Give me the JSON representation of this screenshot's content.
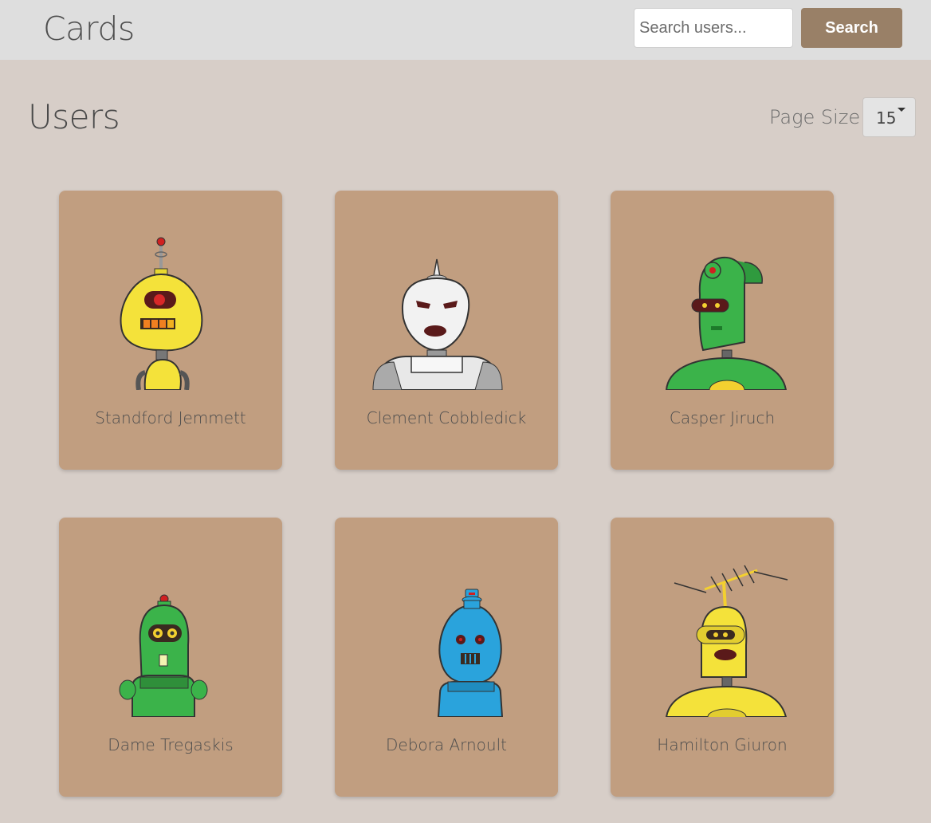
{
  "navbar": {
    "brand": "Cards",
    "search_placeholder": "Search users...",
    "search_value": "",
    "search_button_label": "Search"
  },
  "main": {
    "title": "Users",
    "page_size_label": "Page Size:",
    "page_size_value": "15"
  },
  "users": [
    {
      "name": "Standford Jemmett",
      "avatar": "yellow-robot-avatar"
    },
    {
      "name": "Clement Cobbledick",
      "avatar": "white-robot-avatar"
    },
    {
      "name": "Casper Jiruch",
      "avatar": "green-robot-avatar"
    },
    {
      "name": "Dame Tregaskis",
      "avatar": "green-robot-avatar"
    },
    {
      "name": "Debora Arnoult",
      "avatar": "blue-robot-avatar"
    },
    {
      "name": "Hamilton Giuron",
      "avatar": "yellow-robot-avatar"
    }
  ],
  "colors": {
    "background": "#d7cec8",
    "navbar": "#dedede",
    "accent": "#998067",
    "card": "#c19e80"
  }
}
